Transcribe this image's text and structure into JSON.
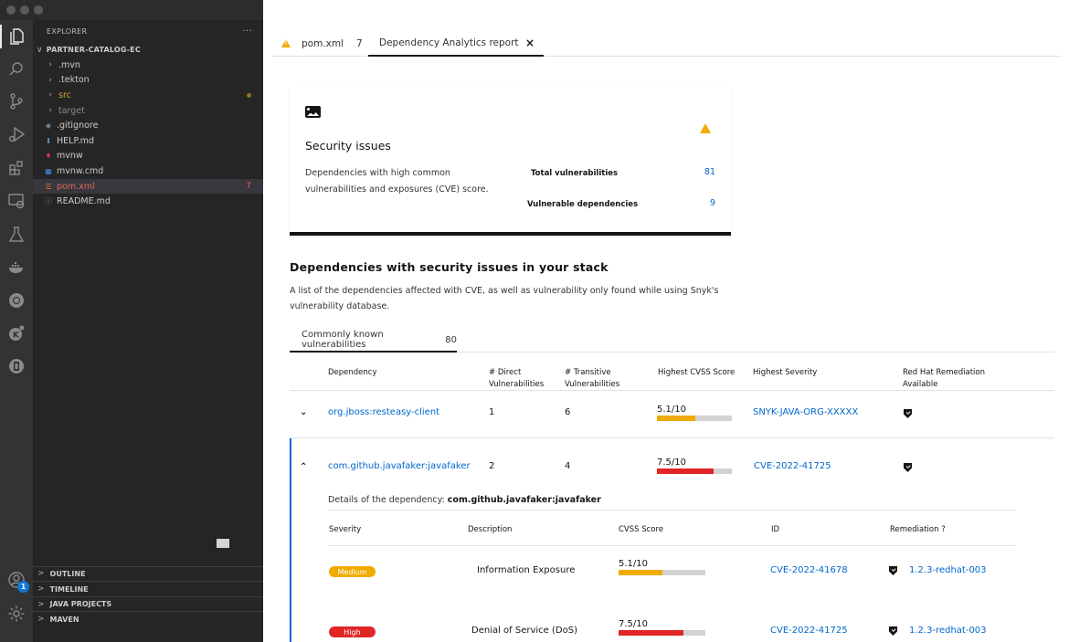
{
  "explorer": {
    "title": "EXPLORER",
    "more": "···",
    "root": "PARTNER-CATALOG-EC",
    "items": [
      {
        "label": ".mvn",
        "type": "folder",
        "color": "#cccccc"
      },
      {
        "label": ".tekton",
        "type": "folder",
        "color": "#cccccc"
      },
      {
        "label": "src",
        "type": "folder",
        "color": "#c9a227",
        "modified": true
      },
      {
        "label": "target",
        "type": "folder",
        "color": "#8c8c8c"
      },
      {
        "label": ".gitignore",
        "type": "file",
        "icon": "git-icon",
        "color": "#cccccc"
      },
      {
        "label": "HELP.md",
        "type": "file",
        "icon": "markdown-icon",
        "color": "#cccccc"
      },
      {
        "label": "mvnw",
        "type": "file",
        "icon": "maven-icon",
        "color": "#cccccc"
      },
      {
        "label": "mvnw.cmd",
        "type": "file",
        "icon": "windows-icon",
        "color": "#cccccc"
      },
      {
        "label": "pom.xml",
        "type": "file",
        "icon": "rss-icon",
        "color": "#e06c5a",
        "count": "7",
        "selected": true
      },
      {
        "label": "README.md",
        "type": "file",
        "icon": "info-icon",
        "color": "#cccccc"
      }
    ],
    "sections": [
      "OUTLINE",
      "TIMELINE",
      "JAVA PROJECTS",
      "MAVEN"
    ],
    "accounts_badge": "1"
  },
  "tabs": [
    {
      "label": "pom.xml",
      "count": "7",
      "icon": "warning-icon"
    },
    {
      "label": "Dependency Analytics report",
      "close": "×",
      "active": true
    }
  ],
  "card": {
    "title": "Security issues",
    "description": "Dependencies with high common vulnerabilities and exposures (CVE) score.",
    "stats": [
      {
        "label": "Total vulnerabilities",
        "value": "81"
      },
      {
        "label": "Vulnerable dependencies",
        "value": "9"
      }
    ]
  },
  "section": {
    "title": "Dependencies with security issues in your stack",
    "description": "A list of the dependencies affected with CVE, as well as vulnerability only found while using Snyk's vulnerability database.",
    "subtab": {
      "label": "Commonly known vulnerabilities",
      "count": "80"
    }
  },
  "table": {
    "headers": {
      "dependency": "Dependency",
      "direct": "# Direct Vulnerabilities",
      "transitive": "# Transitive Vulnerabilities",
      "cvss": "Highest CVSS Score",
      "severity": "Highest Severity",
      "remediation": "Red Hat Remediation Available"
    },
    "rows": [
      {
        "dependency": "org.jboss:resteasy-client",
        "direct": "1",
        "transitive": "6",
        "cvss_label": "5.1/10",
        "cvss": 5.1,
        "cvss_color": "#f0ab00",
        "severity_id": "SNYK-JAVA-ORG-XXXXX",
        "expanded": false
      },
      {
        "dependency": "com.github.javafaker:javafaker",
        "direct": "2",
        "transitive": "4",
        "cvss_label": "7.5/10",
        "cvss": 7.5,
        "cvss_color": "#e02626",
        "severity_id": "CVE-2022-41725",
        "expanded": true
      }
    ]
  },
  "details": {
    "prefix": "Details of the dependency:",
    "name": "com.github.javafaker:javafaker",
    "headers": {
      "severity": "Severity",
      "description": "Description",
      "cvss": "CVSS Score",
      "id": "ID",
      "remediation": "Remediation ?"
    },
    "rows": [
      {
        "severity": "Medium",
        "severity_color": "#f0ab00",
        "description": "Information Exposure",
        "cvss_label": "5.1/10",
        "cvss": 5.1,
        "cvss_color": "#f0ab00",
        "id": "CVE-2022-41678",
        "remediation": "1.2.3-redhat-003"
      },
      {
        "severity": "High",
        "severity_color": "#e02626",
        "description": "Denial of Service (DoS)",
        "cvss_label": "7.5/10",
        "cvss": 7.5,
        "cvss_color": "#e02626",
        "id": "CVE-2022-41725",
        "remediation": "1.2.3-redhat-003"
      }
    ]
  }
}
